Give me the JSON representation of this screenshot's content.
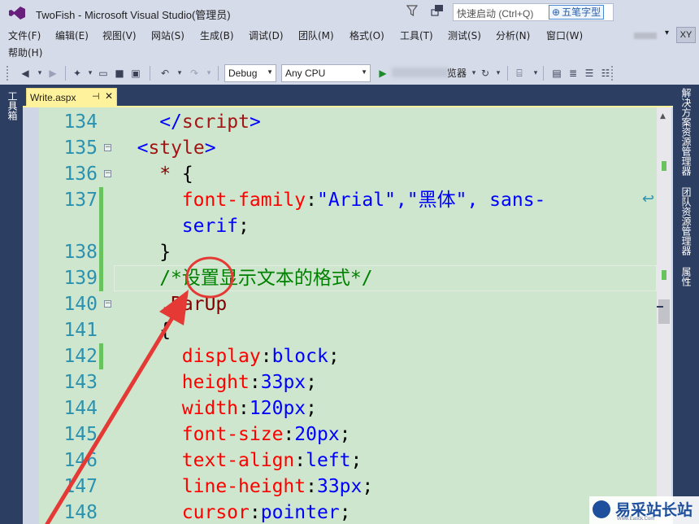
{
  "window": {
    "title": "TwoFish - Microsoft Visual Studio(管理员)",
    "quick_launch_placeholder": "快速启动 (Ctrl+Q)",
    "ime_label": "五笔字型",
    "user_initials": "XY"
  },
  "menu": {
    "row1": [
      "文件(F)",
      "编辑(E)",
      "视图(V)",
      "网站(S)",
      "生成(B)",
      "调试(D)",
      "团队(M)",
      "格式(O)",
      "工具(T)",
      "测试(S)",
      "分析(N)",
      "窗口(W)"
    ],
    "row2": [
      "帮助(H)"
    ]
  },
  "toolbar": {
    "config": "Debug",
    "platform": "Any CPU",
    "start_suffix": "览器"
  },
  "left_panel": {
    "toolbox": "工具箱"
  },
  "right_panel": {
    "solution_explorer": "解决方案资源管理器",
    "team_explorer": "团队资源管理器",
    "properties": "属性"
  },
  "tab": {
    "label": "Write.aspx",
    "pin": "⊣",
    "close": "✕"
  },
  "editor": {
    "lines": [
      {
        "n": "134",
        "fold": "",
        "chg": false,
        "indent": 4,
        "segs": [
          [
            "</",
            "c-bracket"
          ],
          [
            "script",
            "c-tag"
          ],
          [
            ">",
            "c-bracket"
          ]
        ]
      },
      {
        "n": "135",
        "fold": "−",
        "chg": false,
        "indent": 2,
        "segs": [
          [
            "<",
            "c-bracket"
          ],
          [
            "style",
            "c-tag"
          ],
          [
            ">",
            "c-bracket"
          ]
        ]
      },
      {
        "n": "136",
        "fold": "−",
        "chg": false,
        "indent": 4,
        "segs": [
          [
            "* ",
            "c-sel"
          ],
          [
            "{",
            "c-punc"
          ]
        ]
      },
      {
        "n": "137",
        "fold": "",
        "chg": true,
        "indent": 6,
        "segs": [
          [
            "font-family",
            "c-prop"
          ],
          [
            ":",
            "c-punc"
          ],
          [
            "\"Arial\",\"黑体\", sans-",
            "c-val"
          ]
        ]
      },
      {
        "n": "",
        "fold": "",
        "chg": true,
        "indent": 6,
        "segs": [
          [
            "serif",
            "c-val"
          ],
          [
            ";",
            "c-punc"
          ]
        ]
      },
      {
        "n": "138",
        "fold": "",
        "chg": true,
        "indent": 4,
        "segs": [
          [
            "}",
            "c-punc"
          ]
        ]
      },
      {
        "n": "139",
        "fold": "",
        "chg": true,
        "indent": 4,
        "segs": [
          [
            "/*设置显示文本的格式*/",
            "c-cmt"
          ]
        ]
      },
      {
        "n": "140",
        "fold": "−",
        "chg": false,
        "indent": 4,
        "segs": [
          [
            ".BarUp",
            "c-sel"
          ]
        ]
      },
      {
        "n": "141",
        "fold": "",
        "chg": false,
        "indent": 4,
        "segs": [
          [
            "{",
            "c-punc"
          ]
        ]
      },
      {
        "n": "142",
        "fold": "",
        "chg": true,
        "indent": 6,
        "segs": [
          [
            "display",
            "c-prop"
          ],
          [
            ":",
            "c-punc"
          ],
          [
            "block",
            "c-val"
          ],
          [
            ";",
            "c-punc"
          ]
        ]
      },
      {
        "n": "143",
        "fold": "",
        "chg": false,
        "indent": 6,
        "segs": [
          [
            "height",
            "c-prop"
          ],
          [
            ":",
            "c-punc"
          ],
          [
            "33px",
            "c-val"
          ],
          [
            ";",
            "c-punc"
          ]
        ]
      },
      {
        "n": "144",
        "fold": "",
        "chg": false,
        "indent": 6,
        "segs": [
          [
            "width",
            "c-prop"
          ],
          [
            ":",
            "c-punc"
          ],
          [
            "120px",
            "c-val"
          ],
          [
            ";",
            "c-punc"
          ]
        ]
      },
      {
        "n": "145",
        "fold": "",
        "chg": false,
        "indent": 6,
        "segs": [
          [
            "font-size",
            "c-prop"
          ],
          [
            ":",
            "c-punc"
          ],
          [
            "20px",
            "c-val"
          ],
          [
            ";",
            "c-punc"
          ]
        ]
      },
      {
        "n": "146",
        "fold": "",
        "chg": false,
        "indent": 6,
        "segs": [
          [
            "text-align",
            "c-prop"
          ],
          [
            ":",
            "c-punc"
          ],
          [
            "left",
            "c-val"
          ],
          [
            ";",
            "c-punc"
          ]
        ]
      },
      {
        "n": "147",
        "fold": "",
        "chg": false,
        "indent": 6,
        "segs": [
          [
            "line-height",
            "c-prop"
          ],
          [
            ":",
            "c-punc"
          ],
          [
            "33px",
            "c-val"
          ],
          [
            ";",
            "c-punc"
          ]
        ]
      },
      {
        "n": "148",
        "fold": "",
        "chg": false,
        "indent": 6,
        "segs": [
          [
            "cursor",
            "c-prop"
          ],
          [
            ":",
            "c-punc"
          ],
          [
            "pointer",
            "c-val"
          ],
          [
            ";",
            "c-punc"
          ]
        ]
      }
    ]
  },
  "watermark": {
    "text": "易采站长站",
    "sub": "Www.Easck.Com"
  },
  "colors": {
    "editor_bg": "#cde6cd",
    "line_number": "#2b91af",
    "annotation": "#e53935",
    "tab_active": "#fff29d",
    "chrome_dark": "#2c3e62"
  }
}
